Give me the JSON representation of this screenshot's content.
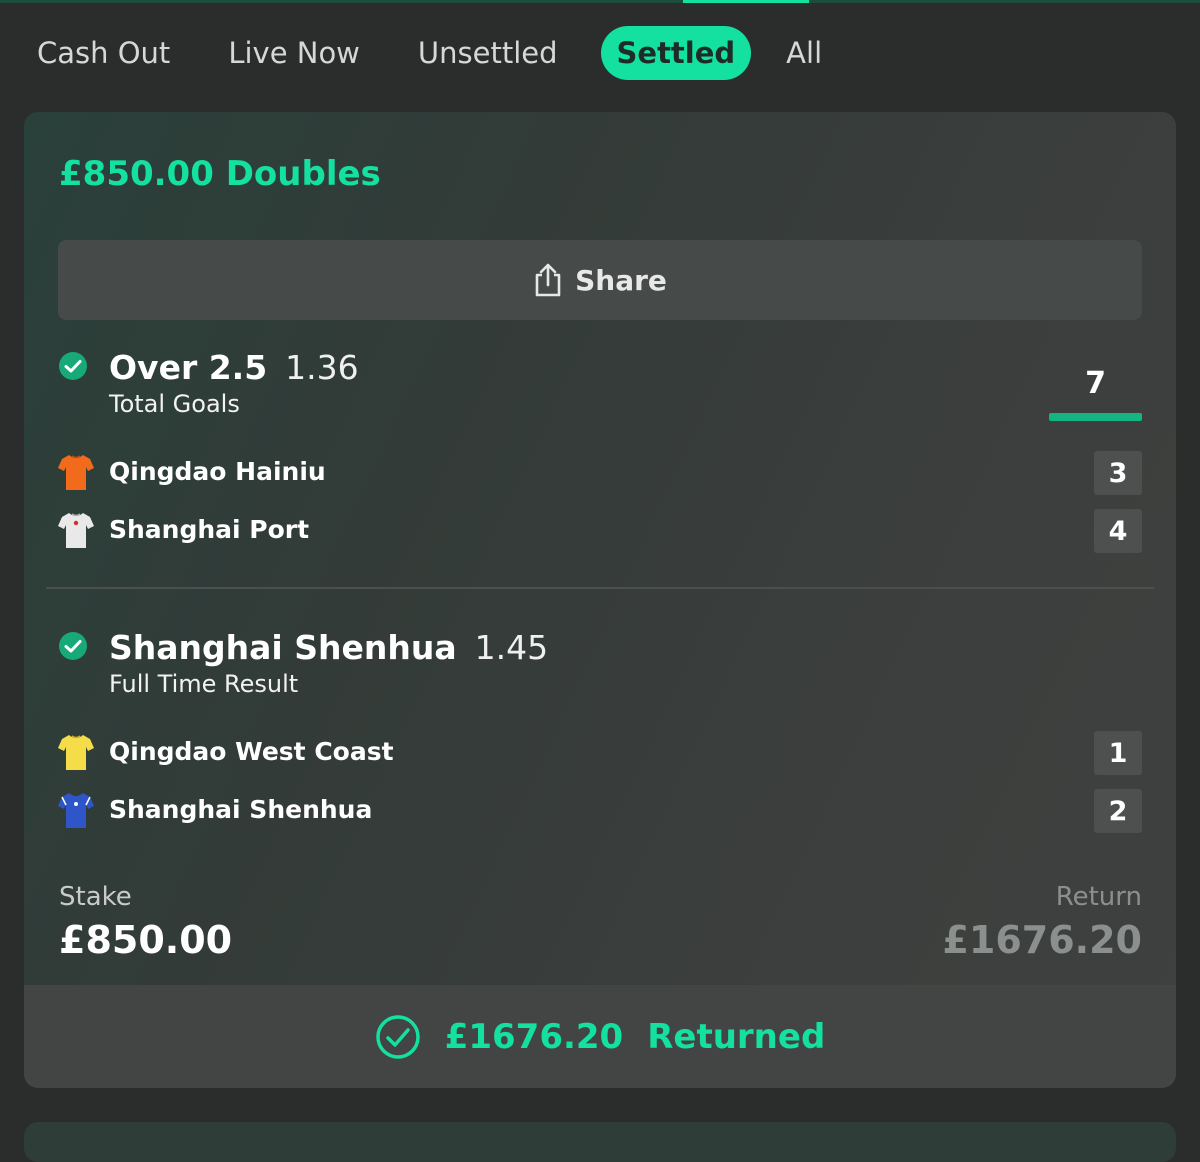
{
  "tabs": [
    {
      "label": "Cash Out",
      "active": false
    },
    {
      "label": "Live Now",
      "active": false
    },
    {
      "label": "Unsettled",
      "active": false
    },
    {
      "label": "Settled",
      "active": true
    },
    {
      "label": "All",
      "active": false
    }
  ],
  "bet": {
    "title": "£850.00 Doubles",
    "share_label": "Share",
    "legs": [
      {
        "selection": "Over 2.5",
        "odds": "1.36",
        "market": "Total Goals",
        "status_icon": "check-circle-icon",
        "total": "7",
        "teams": [
          {
            "name": "Qingdao Hainiu",
            "score": "3",
            "shirt_color": "#f26a1b"
          },
          {
            "name": "Shanghai Port",
            "score": "4",
            "shirt_color": "#e9e9e9"
          }
        ]
      },
      {
        "selection": "Shanghai Shenhua",
        "odds": "1.45",
        "market": "Full Time Result",
        "status_icon": "check-circle-icon",
        "teams": [
          {
            "name": "Qingdao West Coast",
            "score": "1",
            "shirt_color": "#f5dd4a"
          },
          {
            "name": "Shanghai Shenhua",
            "score": "2",
            "shirt_color": "#2f56c9"
          }
        ]
      }
    ],
    "stake_label": "Stake",
    "stake_value": "£850.00",
    "return_label": "Return",
    "return_value": "£1676.20",
    "returned_amount": "£1676.20",
    "returned_label": "Returned"
  },
  "colors": {
    "accent": "#14e0a0",
    "background": "#2b2c2c",
    "card": "#3a3d3c",
    "score_box": "#4d504e"
  }
}
